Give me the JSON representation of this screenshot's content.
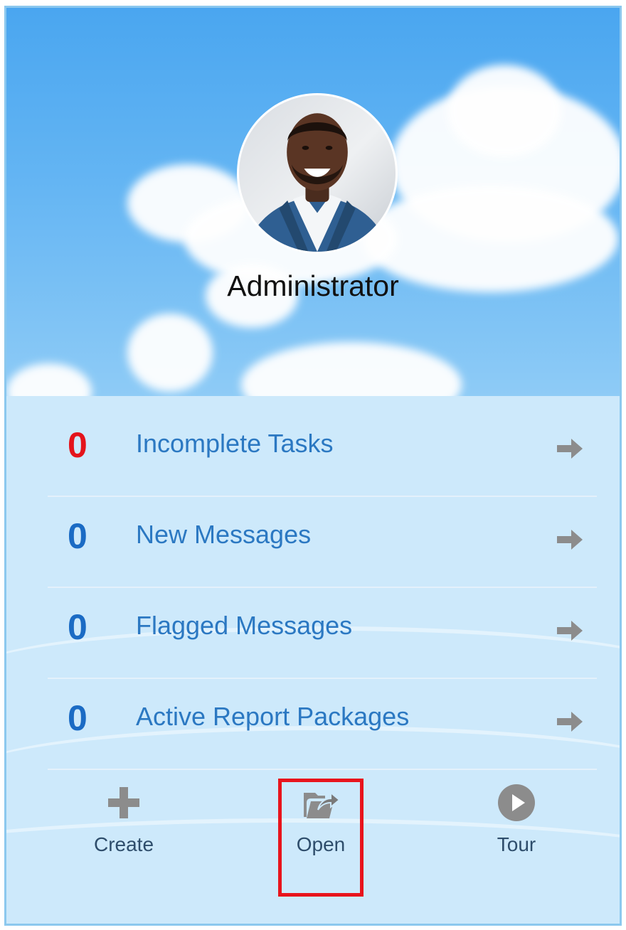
{
  "user": {
    "name": "Administrator"
  },
  "stats": [
    {
      "count": "0",
      "label": "Incomplete Tasks",
      "color": "#e4141b"
    },
    {
      "count": "0",
      "label": "New Messages",
      "color": "#1b6bc4"
    },
    {
      "count": "0",
      "label": "Flagged Messages",
      "color": "#1b6bc4"
    },
    {
      "count": "0",
      "label": "Active Report Packages",
      "color": "#1b6bc4"
    }
  ],
  "actions": {
    "create": {
      "label": "Create",
      "icon": "plus-icon"
    },
    "open": {
      "label": "Open",
      "icon": "open-folder-icon"
    },
    "tour": {
      "label": "Tour",
      "icon": "play-circle-icon"
    }
  },
  "colors": {
    "accent": "#2b78c2",
    "alert": "#e4141b",
    "highlight_box": "#e8141c",
    "icon_gray": "#8c8c8c"
  }
}
